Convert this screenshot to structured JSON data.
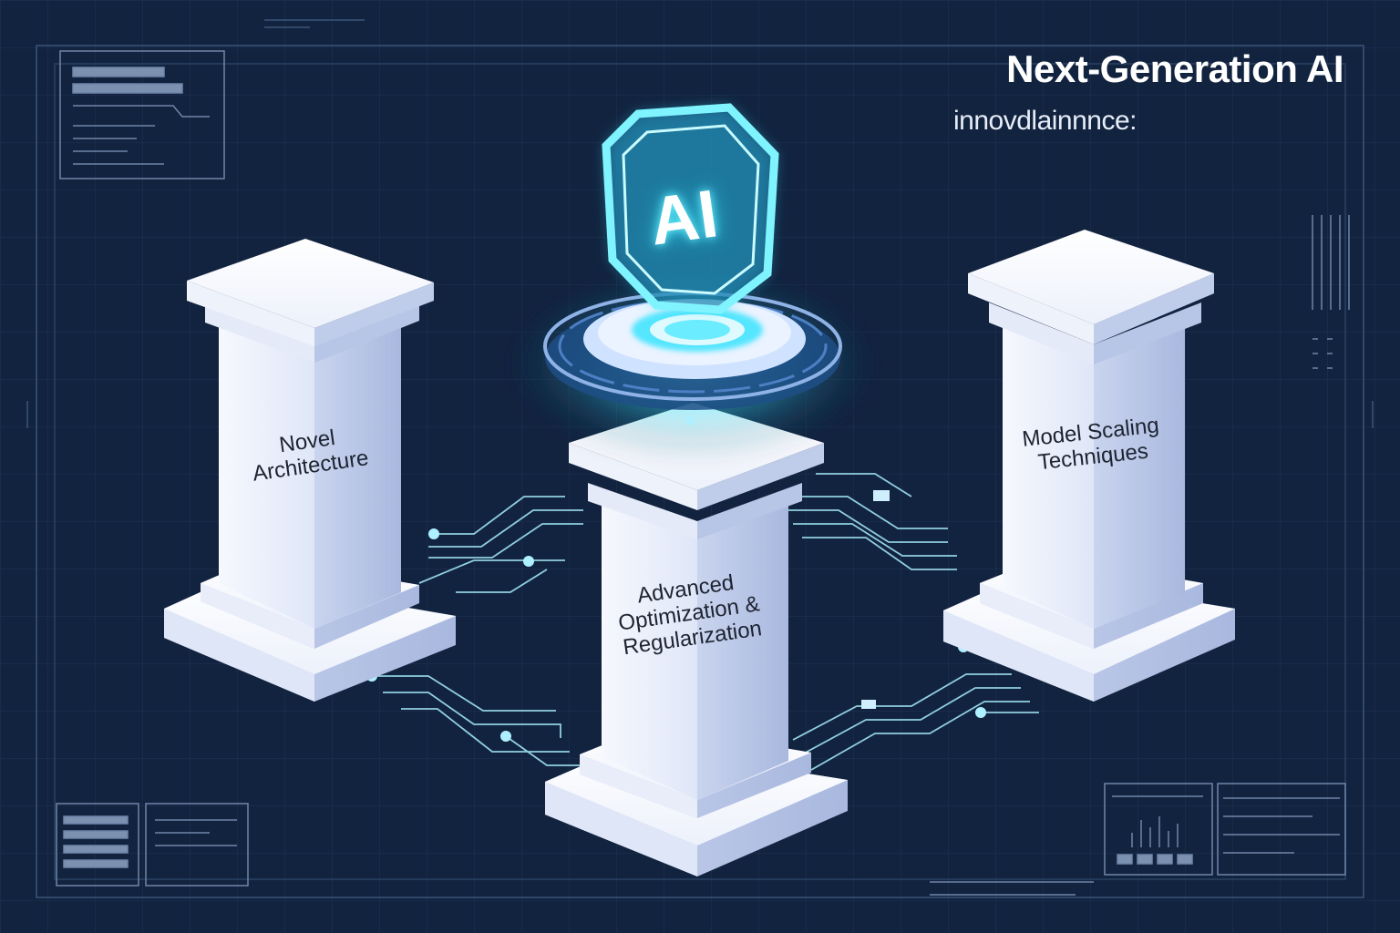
{
  "header": {
    "title": "Next-Generation AI",
    "subtitle": "innovdlainnnce:"
  },
  "badge": {
    "text": "AI",
    "icon": "ai-chip-icon"
  },
  "pillars": {
    "left": "Novel\nArchitecture",
    "center": "Advanced\nOptimization &\nRegularization",
    "right": "Model Scaling\nTechniques"
  },
  "colors": {
    "background": "#12233f",
    "grid": "#1f3454",
    "pillar": "#eef2fb",
    "glow": "#3ee7ff",
    "circuit": "#8fdcef"
  }
}
